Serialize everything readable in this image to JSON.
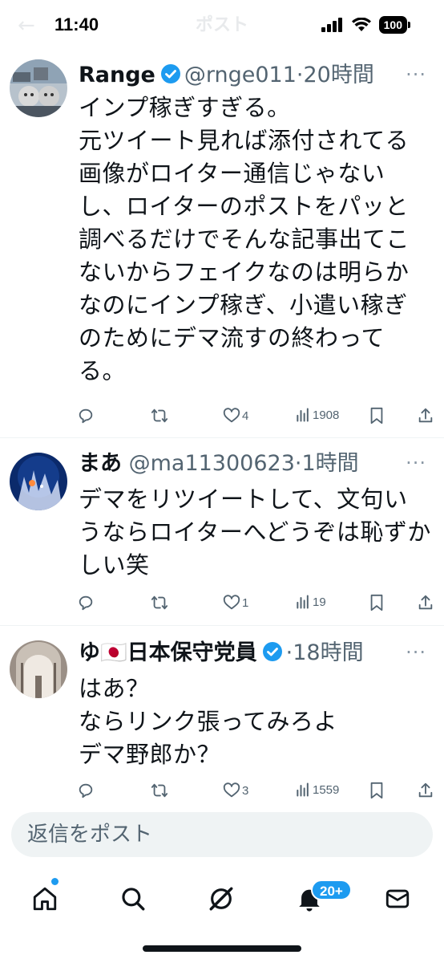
{
  "status_bar": {
    "time": "11:40",
    "battery": "100"
  },
  "header": {
    "title": "ポスト",
    "back_glyph": "←"
  },
  "tweets": [
    {
      "name": "Range",
      "handle": "@rnge011",
      "sep": "·",
      "time": "20時間",
      "text": "インプ稼ぎすぎる。\n元ツイート見れば添付されてる画像がロイター通信じゃないし、ロイターのポストをパッと調べるだけでそんな記事出てこないからフェイクなのは明らかなのにインプ稼ぎ、小遣い稼ぎのためにデマ流すの終わってる。",
      "likes": "4",
      "views": "1908",
      "verified": true
    },
    {
      "name": "まあ",
      "handle": "@ma11300623",
      "sep": "·",
      "time": "1時間",
      "text": "デマをリツイートして、文句いうならロイターへどうぞは恥ずかしい笑",
      "likes": "1",
      "views": "19",
      "verified": false
    },
    {
      "name": "ゆ🇯🇵日本保守党員",
      "handle": "",
      "sep": "·",
      "time": "18時間",
      "text": "はあ？\nならリンク張ってみろよ\nデマ野郎か？",
      "likes": "3",
      "views": "1559",
      "verified": true
    }
  ],
  "more_glyph": "···",
  "reply": {
    "placeholder": "返信をポスト"
  },
  "nav": {
    "notifications_badge": "20+"
  },
  "colors": {
    "accent": "#1d9bf0",
    "text": "#0f1419",
    "muted": "#536471"
  },
  "icons": [
    "reply-icon",
    "retweet-icon",
    "like-icon",
    "views-icon",
    "bookmark-icon",
    "share-icon",
    "home-icon",
    "search-icon",
    "grok-icon",
    "bell-icon",
    "mail-icon"
  ]
}
